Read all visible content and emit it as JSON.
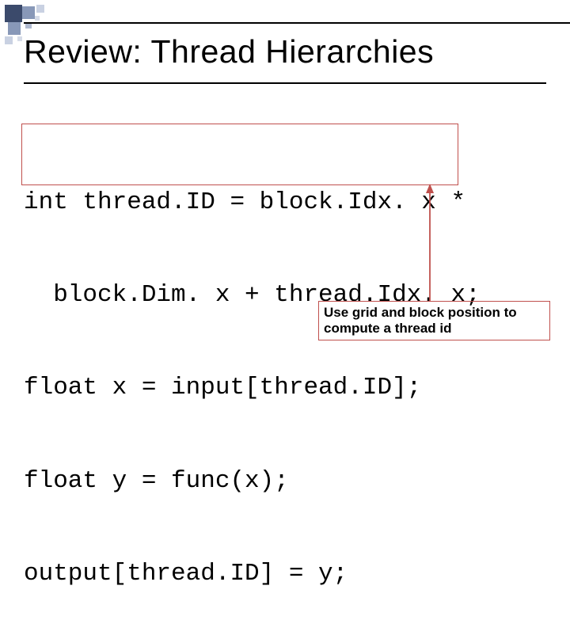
{
  "title": "Review:  Thread Hierarchies",
  "code": {
    "line1": "int thread.ID = block.Idx. x *",
    "line2": "  block.Dim. x + thread.Idx. x;",
    "line3": "float x = input[thread.ID];",
    "line4": "float y = func(x);",
    "line5": "output[thread.ID] = y;"
  },
  "annotation": "Use grid and block position to compute a thread id",
  "colors": {
    "accent": "#c0504d",
    "text": "#000000"
  }
}
